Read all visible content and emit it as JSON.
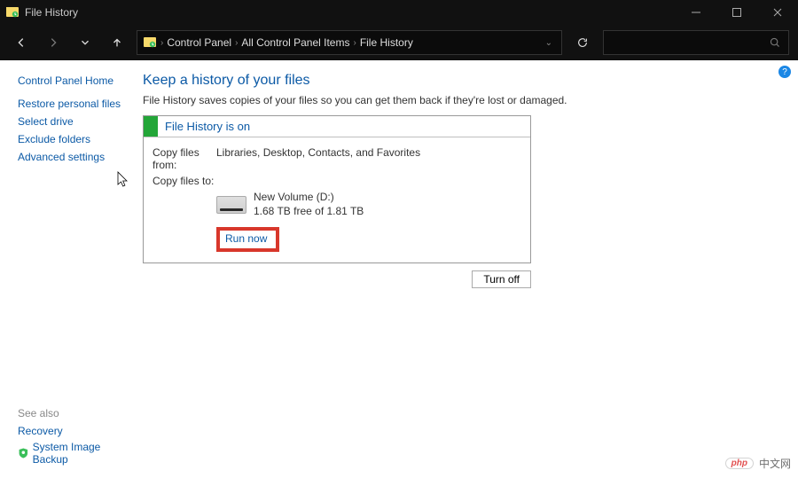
{
  "titlebar": {
    "title": "File History"
  },
  "nav": {
    "breadcrumb": [
      "Control Panel",
      "All Control Panel Items",
      "File History"
    ]
  },
  "sidebar": {
    "home": "Control Panel Home",
    "links": [
      "Restore personal files",
      "Select drive",
      "Exclude folders",
      "Advanced settings"
    ],
    "see_also_label": "See also",
    "recovery": "Recovery",
    "system_image_backup": "System Image Backup"
  },
  "main": {
    "heading": "Keep a history of your files",
    "subtext": "File History saves copies of your files so you can get them back if they're lost or damaged.",
    "status_title": "File History is on",
    "copy_from_label": "Copy files from:",
    "copy_from_value": "Libraries, Desktop, Contacts, and Favorites",
    "copy_to_label": "Copy files to:",
    "drive_name": "New Volume (D:)",
    "drive_free": "1.68 TB free of 1.81 TB",
    "run_now": "Run now",
    "turn_off": "Turn off"
  },
  "watermark": {
    "brand_a": "php",
    "brand_b": "中文网"
  }
}
